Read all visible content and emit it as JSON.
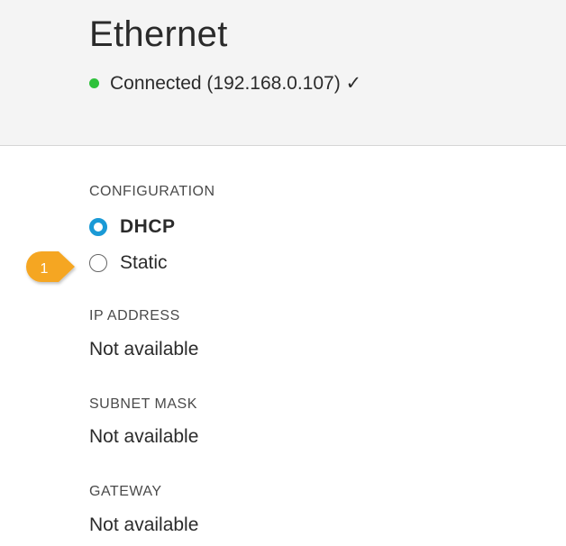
{
  "header": {
    "title": "Ethernet",
    "status_text": "Connected (192.168.0.107) ✓",
    "status_color": "#2ec13b"
  },
  "configuration": {
    "label": "CONFIGURATION",
    "options": [
      {
        "label": "DHCP",
        "selected": true
      },
      {
        "label": "Static",
        "selected": false
      }
    ],
    "accent_color": "#1a9ad6"
  },
  "callout": {
    "number": "1",
    "color": "#f5a623"
  },
  "fields": [
    {
      "label": "IP ADDRESS",
      "value": "Not available"
    },
    {
      "label": "SUBNET MASK",
      "value": "Not available"
    },
    {
      "label": "GATEWAY",
      "value": "Not available"
    }
  ]
}
